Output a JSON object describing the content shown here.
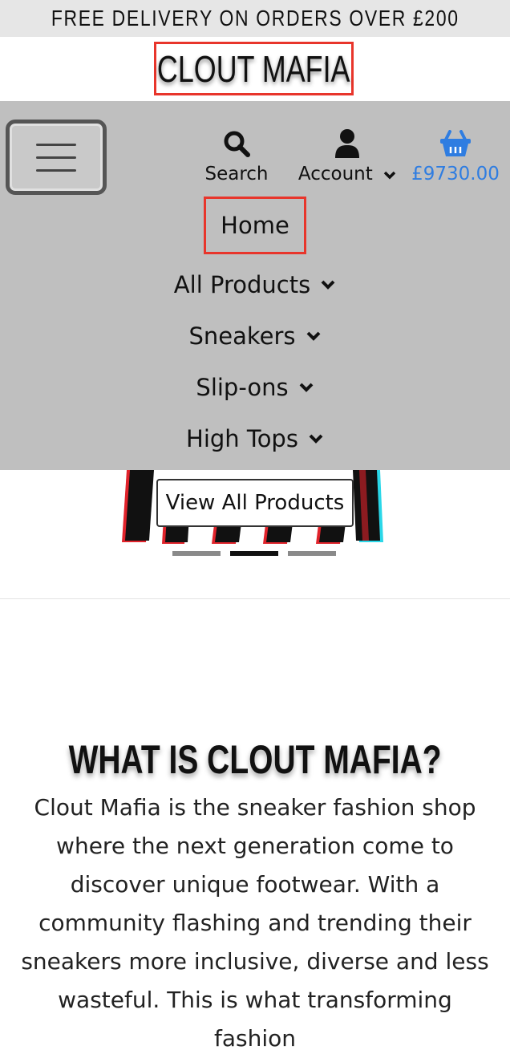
{
  "banner": {
    "text": "FREE DELIVERY ON ORDERS OVER £200"
  },
  "brand": {
    "logo_text": "CLOUT MAFIA",
    "highlight_color": "#e8352b"
  },
  "toolbar": {
    "menu_toggle_icon": "hamburger-icon",
    "search": {
      "label": "Search",
      "icon": "search-icon"
    },
    "account": {
      "label": "Account",
      "icon": "user-icon"
    },
    "cart": {
      "total": "£9730.00",
      "icon": "basket-icon",
      "color": "#2f7de1"
    }
  },
  "nav": {
    "items": [
      {
        "label": "Home",
        "has_dropdown": false,
        "highlighted": true
      },
      {
        "label": "All Products",
        "has_dropdown": true
      },
      {
        "label": "Sneakers",
        "has_dropdown": true
      },
      {
        "label": "Slip-ons",
        "has_dropdown": true
      },
      {
        "label": "High Tops",
        "has_dropdown": true
      }
    ]
  },
  "hero": {
    "cta_label": "View All Products",
    "carousel": {
      "slide_count": 3,
      "active_index": 1
    }
  },
  "about": {
    "title": "WHAT IS CLOUT MAFIA?",
    "body": "Clout Mafia is the sneaker fashion shop where the next generation come to discover unique footwear. With a community flashing and trending their sneakers more inclusive, diverse and less wasteful. This is what transforming fashion"
  }
}
